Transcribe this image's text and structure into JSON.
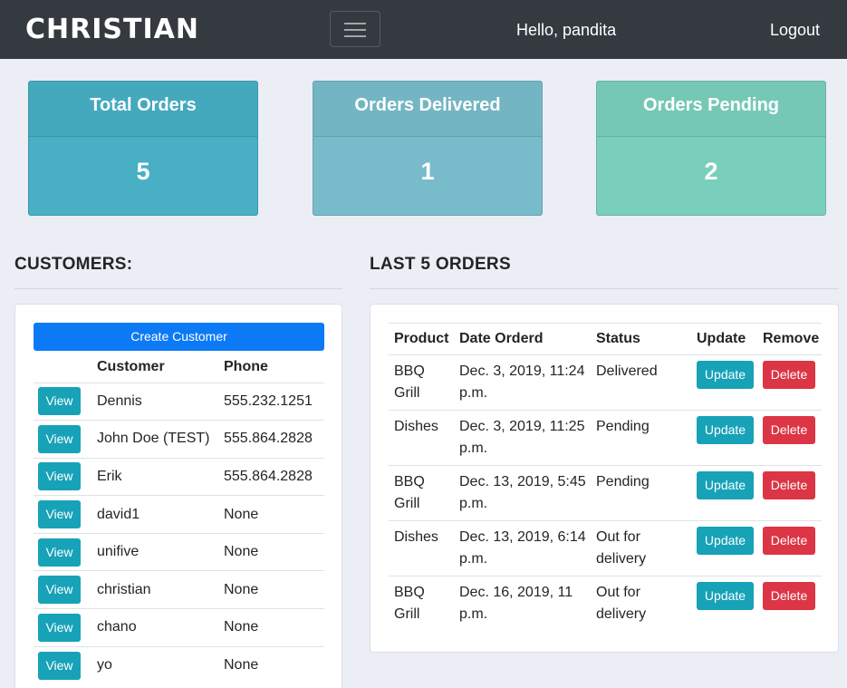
{
  "navbar": {
    "brand": "CHRISTIAN",
    "greeting": "Hello, pandita",
    "logout": "Logout"
  },
  "stats": [
    {
      "label": "Total Orders",
      "value": "5",
      "color": "#48afc5"
    },
    {
      "label": "Orders Delivered",
      "value": "1",
      "color": "#78bbca"
    },
    {
      "label": "Orders Pending",
      "value": "2",
      "color": "#7acfbc"
    }
  ],
  "customers": {
    "title": "CUSTOMERS:",
    "create_label": "Create Customer",
    "headers": {
      "customer": "Customer",
      "phone": "Phone"
    },
    "view_label": "View",
    "rows": [
      {
        "name": "Dennis",
        "phone": "555.232.1251"
      },
      {
        "name": "John Doe (TEST)",
        "phone": "555.864.2828"
      },
      {
        "name": "Erik",
        "phone": "555.864.2828"
      },
      {
        "name": "david1",
        "phone": "None"
      },
      {
        "name": "unifive",
        "phone": "None"
      },
      {
        "name": "christian",
        "phone": "None"
      },
      {
        "name": "chano",
        "phone": "None"
      },
      {
        "name": "yo",
        "phone": "None"
      }
    ]
  },
  "orders": {
    "title": "LAST 5 ORDERS",
    "headers": {
      "product": "Product",
      "date": "Date Orderd",
      "status": "Status",
      "update": "Update",
      "remove": "Remove"
    },
    "update_label": "Update",
    "delete_label": "Delete",
    "rows": [
      {
        "product": "BBQ Grill",
        "date": "Dec. 3, 2019, 11:24 p.m.",
        "status": "Delivered"
      },
      {
        "product": "Dishes",
        "date": "Dec. 3, 2019, 11:25 p.m.",
        "status": "Pending"
      },
      {
        "product": "BBQ Grill",
        "date": "Dec. 13, 2019, 5:45 p.m.",
        "status": "Pending"
      },
      {
        "product": "Dishes",
        "date": "Dec. 13, 2019, 6:14 p.m.",
        "status": "Out for delivery"
      },
      {
        "product": "BBQ Grill",
        "date": "Dec. 16, 2019, 11 p.m.",
        "status": "Out for delivery"
      }
    ]
  }
}
